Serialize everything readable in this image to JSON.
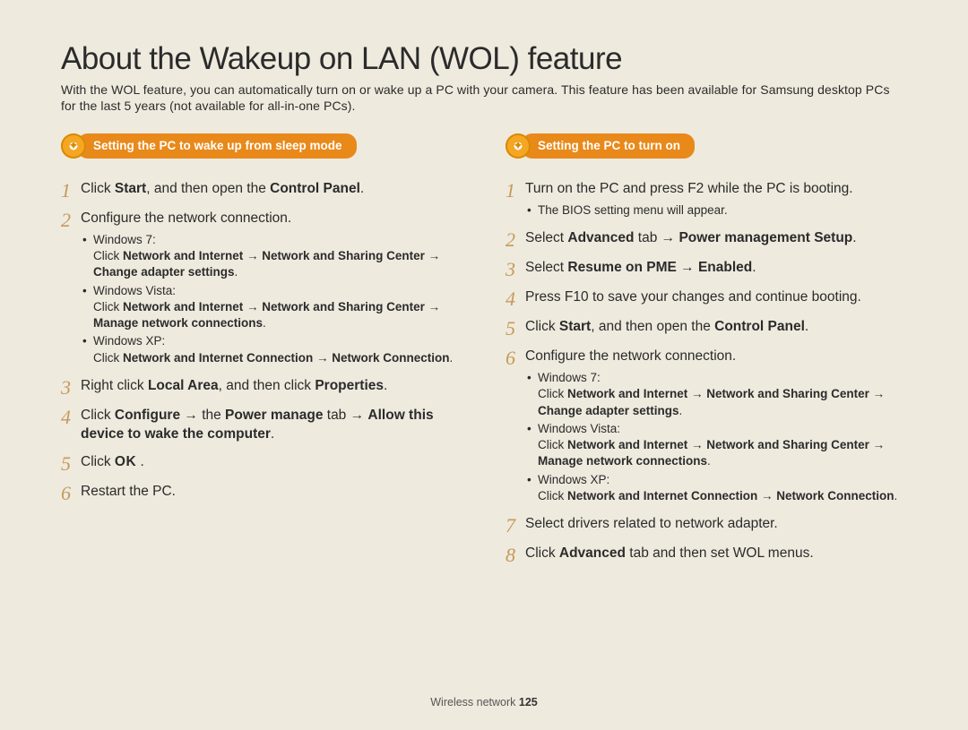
{
  "title": "About the Wakeup on LAN (WOL) feature",
  "intro": "With the WOL feature, you can automatically turn on or wake up a PC with your camera. This feature has been available for Samsung desktop PCs for the last 5 years (not available for all-in-one PCs).",
  "left_heading": "Setting the PC to wake up from sleep mode",
  "right_heading": "Setting the PC to turn on",
  "left": {
    "s1_a": "Click ",
    "s1_b": "Start",
    "s1_c": ", and then open the ",
    "s1_d": "Control Panel",
    "s1_e": ".",
    "s2": "Configure the network connection.",
    "s2_w7_label": "Windows 7:",
    "s2_w7_a": "Click ",
    "s2_w7_b": "Network and Internet",
    "s2_w7_c": " → ",
    "s2_w7_d": "Network and Sharing Center",
    "s2_w7_e": " → ",
    "s2_w7_f": "Change adapter settings",
    "s2_w7_g": ".",
    "s2_wv_label": "Windows Vista:",
    "s2_wv_a": "Click ",
    "s2_wv_b": "Network and Internet",
    "s2_wv_c": " → ",
    "s2_wv_d": "Network and Sharing Center",
    "s2_wv_e": " → ",
    "s2_wv_f": "Manage network connections",
    "s2_wv_g": ".",
    "s2_wxp_label": "Windows XP:",
    "s2_wxp_a": "Click ",
    "s2_wxp_b": "Network and Internet Connection",
    "s2_wxp_c": " → ",
    "s2_wxp_d": "Network Connection",
    "s2_wxp_e": ".",
    "s3_a": "Right click ",
    "s3_b": "Local Area",
    "s3_c": ", and then click ",
    "s3_d": "Properties",
    "s3_e": ".",
    "s4_a": "Click ",
    "s4_b": "Configure",
    "s4_c": " → the ",
    "s4_d": "Power manage",
    "s4_e": " tab → ",
    "s4_f": "Allow this device to wake the computer",
    "s4_g": ".",
    "s5_a": "Click ",
    "s5_ok": "OK",
    "s5_b": " .",
    "s6": "Restart the PC."
  },
  "right": {
    "s1": "Turn on the PC and press F2 while the PC is booting.",
    "s1_sub": "The BIOS setting menu will appear.",
    "s2_a": "Select ",
    "s2_b": "Advanced",
    "s2_c": " tab → ",
    "s2_d": "Power management Setup",
    "s2_e": ".",
    "s3_a": "Select ",
    "s3_b": "Resume on PME",
    "s3_c": " → ",
    "s3_d": "Enabled",
    "s3_e": ".",
    "s4": "Press F10 to save your changes and continue booting.",
    "s5_a": "Click ",
    "s5_b": "Start",
    "s5_c": ", and then open the ",
    "s5_d": "Control Panel",
    "s5_e": ".",
    "s6": "Configure the network connection.",
    "s6_w7_label": "Windows 7:",
    "s6_w7_a": "Click ",
    "s6_w7_b": "Network and Internet",
    "s6_w7_c": " → ",
    "s6_w7_d": "Network and Sharing Center",
    "s6_w7_e": " → ",
    "s6_w7_f": "Change adapter settings",
    "s6_w7_g": ".",
    "s6_wv_label": "Windows Vista:",
    "s6_wv_a": "Click ",
    "s6_wv_b": "Network and Internet",
    "s6_wv_c": " → ",
    "s6_wv_d": "Network and Sharing Center",
    "s6_wv_e": " → ",
    "s6_wv_f": "Manage network connections",
    "s6_wv_g": ".",
    "s6_wxp_label": "Windows XP:",
    "s6_wxp_a": "Click ",
    "s6_wxp_b": "Network and Internet Connection",
    "s6_wxp_c": " → ",
    "s6_wxp_d": "Network Connection",
    "s6_wxp_e": ".",
    "s7": "Select drivers related to network adapter.",
    "s8_a": "Click ",
    "s8_b": "Advanced",
    "s8_c": " tab and then set WOL menus."
  },
  "footer_label": "Wireless network  ",
  "footer_page": "125"
}
